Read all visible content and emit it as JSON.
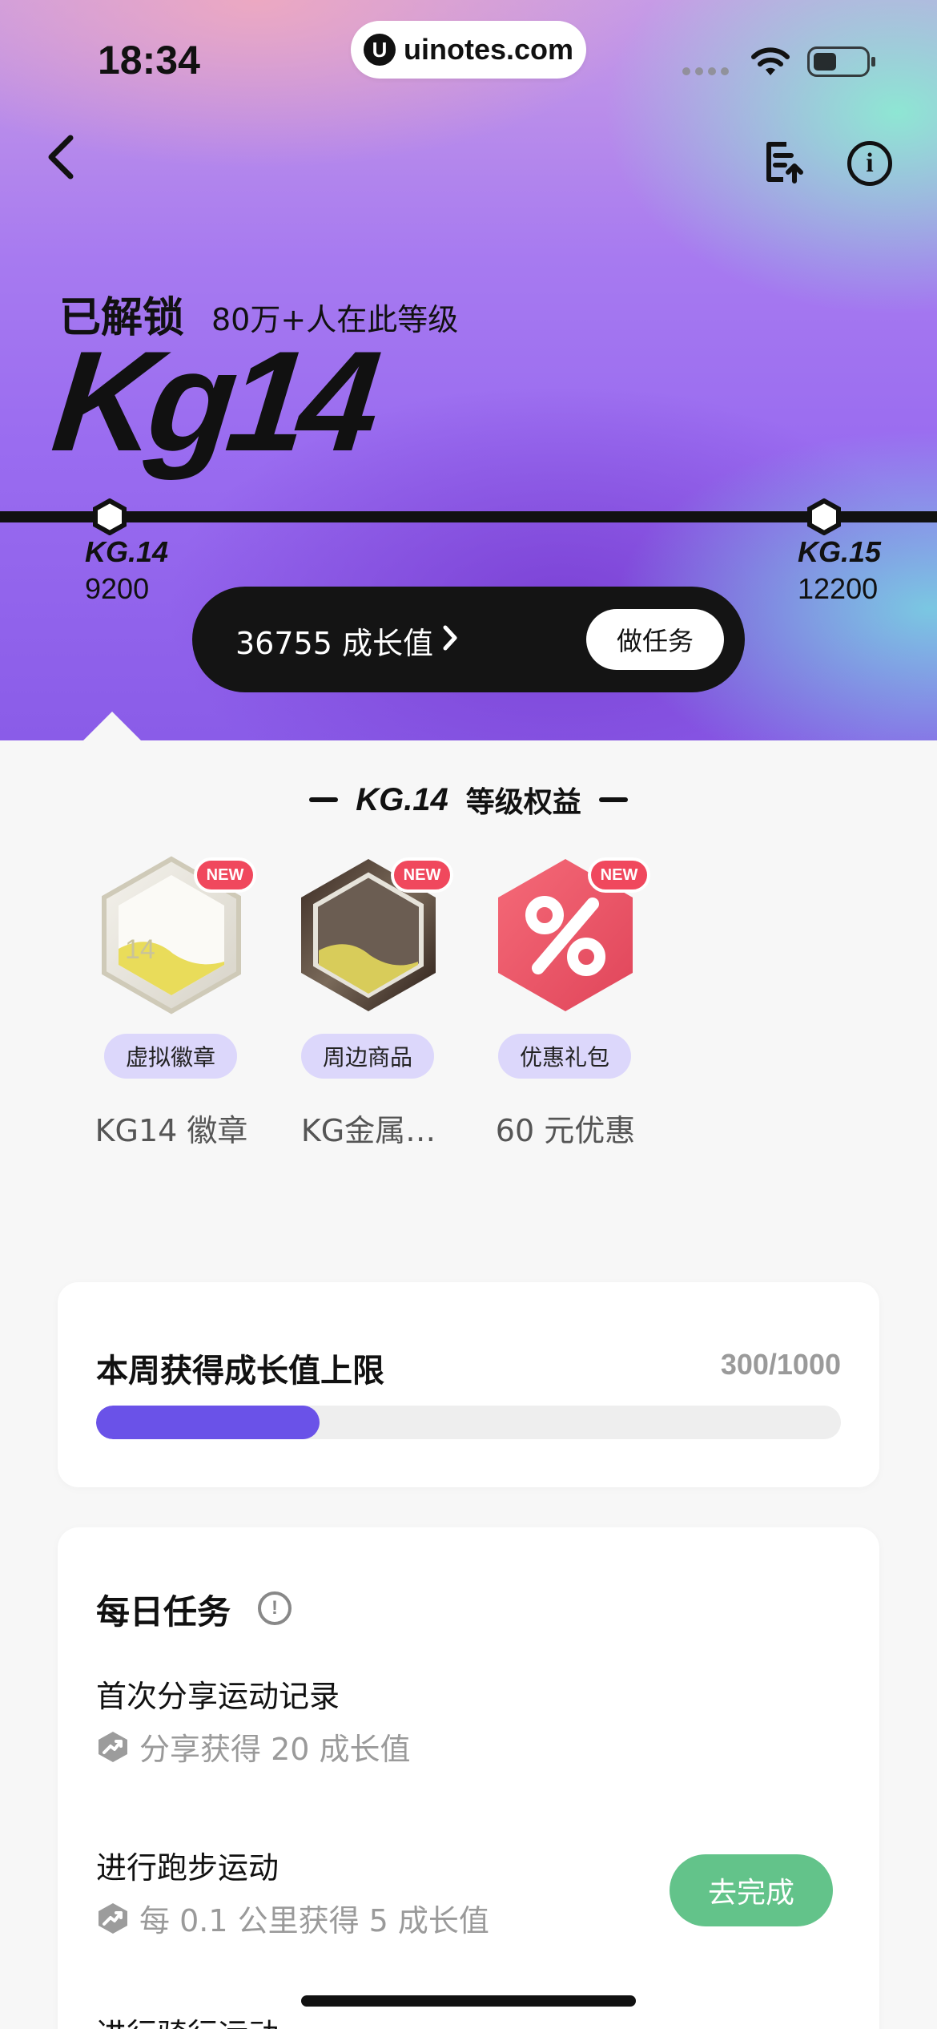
{
  "status_bar": {
    "time": "18:34",
    "url": "uinotes.com",
    "url_logo": "U"
  },
  "header": {
    "info_glyph": "i"
  },
  "hero": {
    "unlocked_label": "已解锁",
    "people_text": "80万+人在此等级",
    "level_big": "Kg14",
    "current_node": {
      "label": "KG.14",
      "value": "9200"
    },
    "next_node": {
      "label": "KG.15",
      "value": "12200"
    },
    "growth_text": "36755 成长值",
    "task_button": "做任务"
  },
  "benefits": {
    "title_level": "KG.14",
    "title_text": "等级权益",
    "new_badge": "NEW",
    "items": [
      {
        "tag": "虚拟徽章",
        "name": "KG14 徽章",
        "icon": "badge-hex-silver-icon"
      },
      {
        "tag": "周边商品",
        "name": "KG金属…",
        "icon": "metal-hex-icon"
      },
      {
        "tag": "优惠礼包",
        "name": "60 元优惠",
        "icon": "discount-percent-icon"
      }
    ]
  },
  "weekly_limit": {
    "title": "本周获得成长值上限",
    "value_text": "300/1000",
    "progress": 0.3,
    "accent": "#6a52e8"
  },
  "daily_tasks": {
    "title": "每日任务",
    "info_glyph": "!",
    "tasks": [
      {
        "title": "首次分享运动记录",
        "reward": "分享获得 20 成长值"
      },
      {
        "title": "进行跑步运动",
        "reward": "每 0.1 公里获得 5 成长值",
        "button": "去完成"
      }
    ],
    "partial_title": "进行骑行运动"
  },
  "colors": {
    "task_button": "#63c38a",
    "badge": "#f0485d",
    "tag_bg": "#dcd7fb"
  }
}
